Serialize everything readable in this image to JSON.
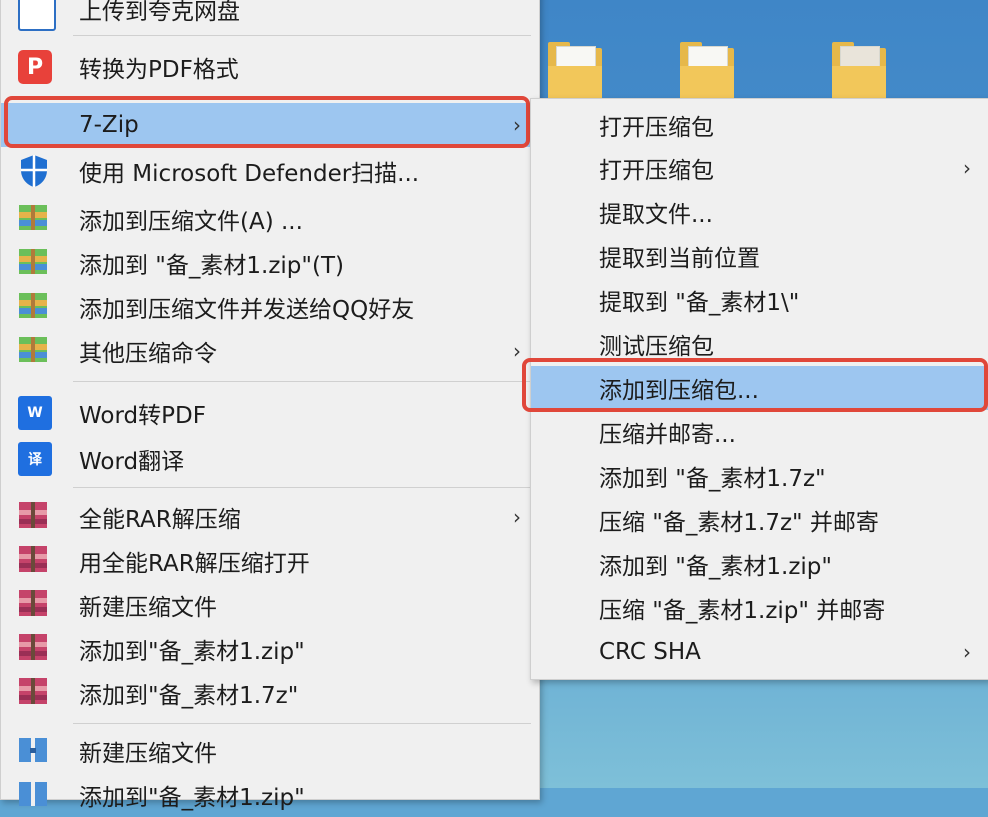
{
  "menu": {
    "items": [
      {
        "label": "上传到夸克网盘",
        "icon": "document-upload-icon"
      },
      {
        "label": "转换为PDF格式",
        "icon": "pdf-icon"
      },
      {
        "label": "7-Zip",
        "icon": "none",
        "submenu": true,
        "selected": true
      },
      {
        "label": "使用 Microsoft Defender扫描...",
        "icon": "shield-icon"
      },
      {
        "label": "添加到压缩文件(A) ...",
        "icon": "archive-icon"
      },
      {
        "label": "添加到 \"备_素材1.zip\"(T)",
        "icon": "archive-icon"
      },
      {
        "label": "添加到压缩文件并发送给QQ好友",
        "icon": "archive-icon"
      },
      {
        "label": "其他压缩命令",
        "icon": "archive-icon",
        "submenu": true
      },
      {
        "label": "Word转PDF",
        "icon": "word-icon"
      },
      {
        "label": "Word翻译",
        "icon": "word-translate-icon"
      },
      {
        "label": "全能RAR解压缩",
        "icon": "rar-icon",
        "submenu": true
      },
      {
        "label": "用全能RAR解压缩打开",
        "icon": "rar-icon"
      },
      {
        "label": "新建压缩文件",
        "icon": "rar-icon"
      },
      {
        "label": "添加到\"备_素材1.zip\"",
        "icon": "rar-icon"
      },
      {
        "label": "添加到\"备_素材1.7z\"",
        "icon": "rar-icon"
      },
      {
        "label": "新建压缩文件",
        "icon": "zip-folder-icon"
      },
      {
        "label": "添加到\"备_素材1.zip\"",
        "icon": "zip-folder-icon"
      }
    ]
  },
  "submenu": {
    "items": [
      {
        "label": "打开压缩包"
      },
      {
        "label": "打开压缩包",
        "submenu": true
      },
      {
        "label": "提取文件..."
      },
      {
        "label": "提取到当前位置"
      },
      {
        "label": "提取到 \"备_素材1\\\""
      },
      {
        "label": "测试压缩包"
      },
      {
        "label": "添加到压缩包...",
        "selected": true
      },
      {
        "label": "压缩并邮寄..."
      },
      {
        "label": "添加到 \"备_素材1.7z\""
      },
      {
        "label": "压缩 \"备_素材1.7z\" 并邮寄"
      },
      {
        "label": "添加到 \"备_素材1.zip\""
      },
      {
        "label": "压缩 \"备_素材1.zip\" 并邮寄"
      },
      {
        "label": "CRC SHA",
        "submenu": true
      }
    ]
  },
  "glyphs": {
    "arrow": "›",
    "pdf": "P",
    "word": "W",
    "translate": "译"
  },
  "colors": {
    "highlight": "#9dc6f0",
    "outline": "#e0473a",
    "menu_bg": "#f0f0f0"
  }
}
